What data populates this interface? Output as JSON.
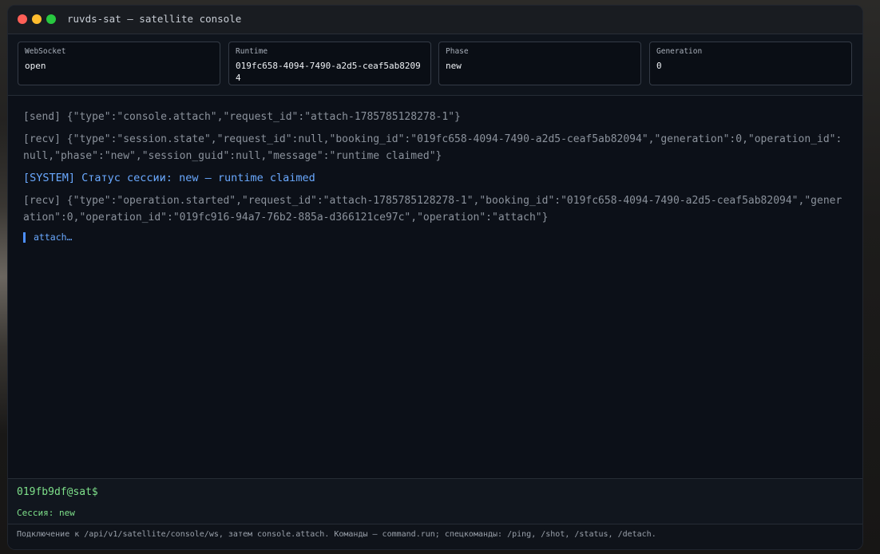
{
  "window": {
    "title": "ruvds-sat — satellite console"
  },
  "stats": [
    {
      "label": "WebSocket",
      "value": "open"
    },
    {
      "label": "Runtime",
      "value": "019fc658-4094-7490-a2d5-ceaf5ab82094"
    },
    {
      "label": "Phase",
      "value": "new"
    },
    {
      "label": "Generation",
      "value": "0"
    }
  ],
  "log": [
    {
      "kind": "send",
      "text": "[send] {\"type\":\"console.attach\",\"request_id\":\"attach-1785785128278-1\"}"
    },
    {
      "kind": "recv",
      "text": "[recv] {\"type\":\"session.state\",\"request_id\":null,\"booking_id\":\"019fc658-4094-7490-a2d5-ceaf5ab82094\",\"generation\":0,\"operation_id\":null,\"phase\":\"new\",\"session_guid\":null,\"message\":\"runtime claimed\"}"
    },
    {
      "kind": "system",
      "text": "[SYSTEM] Статус сессии: new — runtime claimed"
    },
    {
      "kind": "recv",
      "text": "[recv] {\"type\":\"operation.started\",\"request_id\":\"attach-1785785128278-1\",\"booking_id\":\"019fc658-4094-7490-a2d5-ceaf5ab82094\",\"generation\":0,\"operation_id\":\"019fc916-94a7-76b2-885a-d366121ce97c\",\"operation\":\"attach\"}"
    }
  ],
  "pending": {
    "text": "attach…"
  },
  "prompt": {
    "label": "019fb9df@sat$",
    "value": "",
    "session": "Сессия: new"
  },
  "footer": {
    "hint": "Подключение к /api/v1/satellite/console/ws, затем console.attach. Команды — command.run; спецкоманды: /ping, /shot, /status, /detach."
  },
  "colors": {
    "prompt_green": "#7ee08a",
    "system_blue": "#6aa9ff",
    "traffic_red": "#ff5f57",
    "traffic_yellow": "#febc2e",
    "traffic_green": "#28c840"
  }
}
